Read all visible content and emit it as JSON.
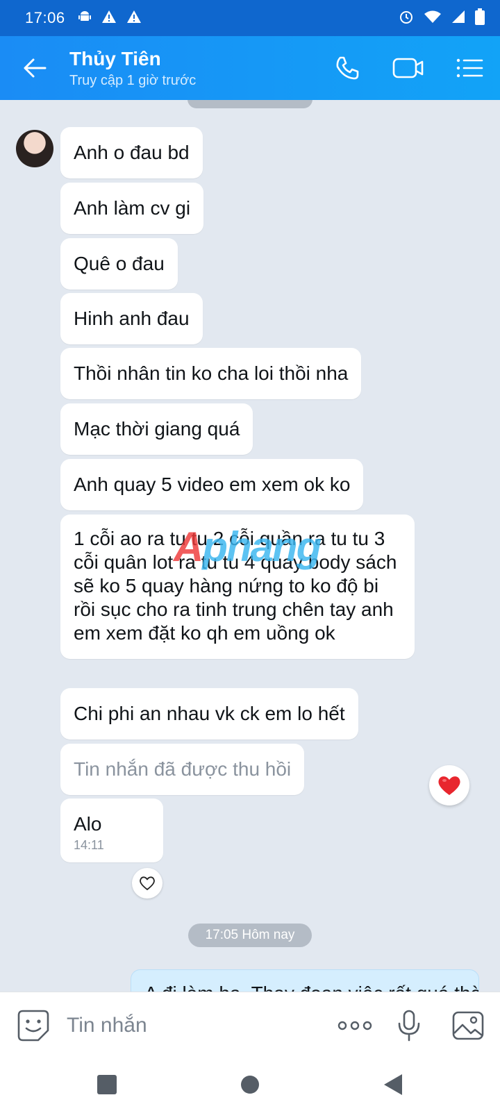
{
  "status_bar": {
    "time": "17:06",
    "left_icons": [
      "android-icon",
      "alert-icon",
      "alert-icon"
    ],
    "right_icons": [
      "alarm-icon",
      "wifi-icon",
      "signal-icon",
      "battery-icon"
    ]
  },
  "header": {
    "contact_name": "Thủy Tiên",
    "last_seen": "Truy cập 1 giờ trước",
    "actions": [
      "phone-icon",
      "video-call-icon",
      "menu-icon"
    ]
  },
  "messages": [
    {
      "text": "Anh o đau bd"
    },
    {
      "text": "Anh làm cv gi"
    },
    {
      "text": "Quê o đau"
    },
    {
      "text": "Hinh anh đau"
    },
    {
      "text": "Thồi nhân tin ko cha loi thồi nha"
    },
    {
      "text": "Mạc thời giang quá"
    },
    {
      "text": "Anh quay 5 video em xem ok ko"
    },
    {
      "text": "1 cỗi ao ra tu tu 2 cỗi quần ra tu tu 3 cỗi quân lot ra tu tu 4 quay body sách sẽ ko 5 quay hàng nứng to ko độ bi rồi sục cho ra tinh trung chên tay anh em xem đặt ko qh em uồng ok"
    },
    {
      "text": "Chi phi an nhau vk ck em lo hết"
    },
    {
      "text": "Tin nhắn đã được thu hồi",
      "recalled": true
    },
    {
      "text": "Alo",
      "time": "14:11"
    }
  ],
  "time_divider": "17:05 Hôm nay",
  "sent_partial": "A đi làm ha. Thay đoạn việc rất quá thời",
  "watermark": {
    "prefix": "A",
    "rest": "phang"
  },
  "colors": {
    "header_start": "#1a8cf5",
    "header_end": "#12a3f7",
    "status": "#0f67ce",
    "chat_bg": "#e2e8f0",
    "sent_bubble": "#d5eefe",
    "heart": "#e8262e"
  },
  "input": {
    "placeholder": "Tin nhắn",
    "tools": [
      "more-icon",
      "microphone-icon",
      "image-icon"
    ]
  },
  "nav": [
    "recent-apps-icon",
    "home-icon",
    "back-icon"
  ]
}
